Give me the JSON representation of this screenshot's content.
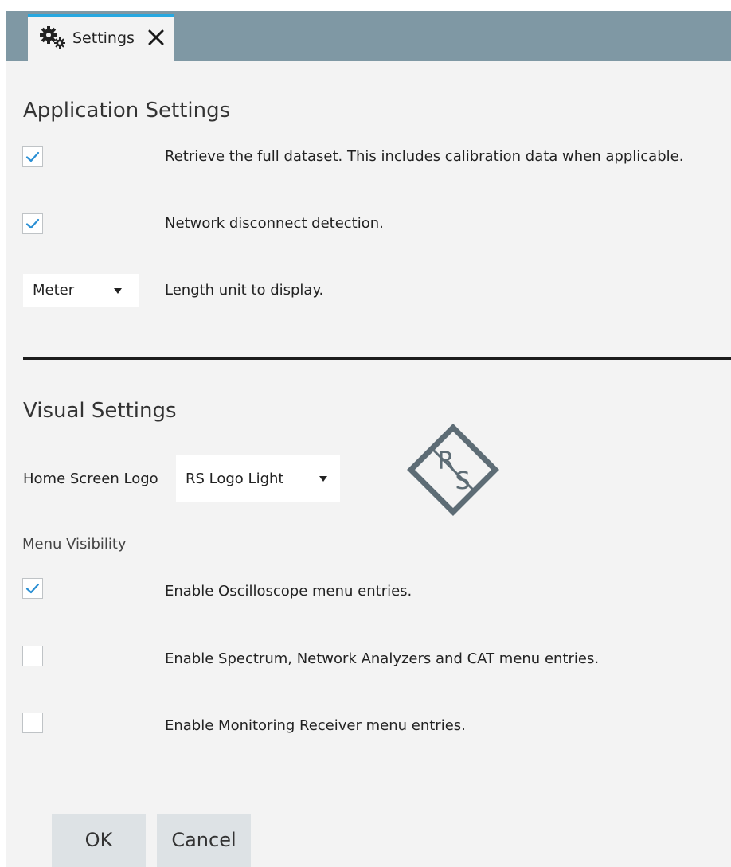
{
  "tab": {
    "icon": "gears-icon",
    "label": "Settings",
    "close_icon": "close-icon"
  },
  "application_settings": {
    "title": "Application Settings",
    "full_dataset": {
      "checked": true,
      "label": "Retrieve the full dataset. This includes calibration data when applicable."
    },
    "network_disconnect": {
      "checked": true,
      "label": "Network disconnect detection."
    },
    "length_unit": {
      "value": "Meter",
      "label": "Length unit to display."
    }
  },
  "visual_settings": {
    "title": "Visual Settings",
    "home_screen_logo": {
      "label": "Home Screen Logo",
      "value": "RS Logo Light"
    },
    "logo_preview": {
      "icon": "rs-logo-icon",
      "letters": "RS"
    },
    "menu_visibility": {
      "heading": "Menu Visibility",
      "items": [
        {
          "checked": true,
          "label": "Enable Oscilloscope menu entries."
        },
        {
          "checked": false,
          "label": "Enable Spectrum, Network Analyzers and CAT menu entries."
        },
        {
          "checked": false,
          "label": "Enable Monitoring Receiver menu entries."
        }
      ]
    }
  },
  "buttons": {
    "ok": "OK",
    "cancel": "Cancel"
  },
  "colors": {
    "tab_bar": "#7f98a4",
    "tab_accent": "#27a8e0",
    "checkmark": "#2a8fd4",
    "logo": "#5d6c75",
    "background": "#f3f3f3"
  }
}
